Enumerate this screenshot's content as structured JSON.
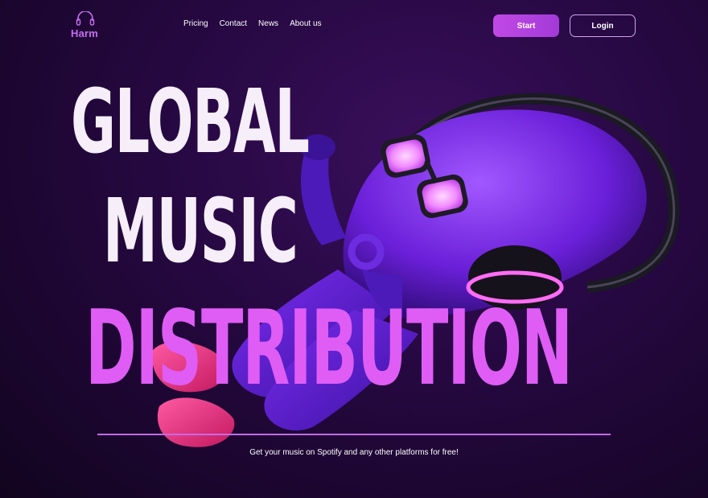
{
  "brand": {
    "name": "Harm",
    "icon": "headphones-icon",
    "color": "#c86cf0"
  },
  "nav": {
    "items": [
      "Pricing",
      "Contact",
      "News",
      "About us"
    ]
  },
  "actions": {
    "start": "Start",
    "login": "Login"
  },
  "hero": {
    "line1": "GLOBAL",
    "line2": "MUSIC",
    "line3": "DISTRIBUTION",
    "tagline": "Get your music on Spotify and any other platforms for free!"
  },
  "illustration": {
    "name": "character-with-headphones-illustration"
  },
  "colors": {
    "accent": "#df5df5",
    "button": "#b545e0",
    "background": "#250840"
  }
}
